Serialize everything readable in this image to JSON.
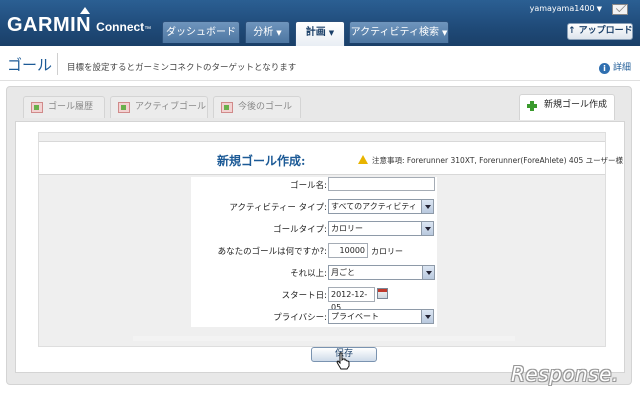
{
  "app": {
    "logo_main": "GARMIN",
    "logo_sub": "Connect",
    "logo_tm": "™",
    "user": "yamayama1400",
    "upload_label": "↑ アップロード"
  },
  "nav": {
    "tabs": [
      {
        "label": "ダッシュボード",
        "active": false,
        "has_menu": false
      },
      {
        "label": "分析",
        "active": false,
        "has_menu": true
      },
      {
        "label": "計画",
        "active": true,
        "has_menu": true
      },
      {
        "label": "アクティビティ検索",
        "active": false,
        "has_menu": true
      }
    ]
  },
  "page": {
    "title": "ゴール",
    "description": "目標を設定するとガーミンコネクトのターゲットとなります",
    "help_label": "詳細"
  },
  "subtabs": [
    {
      "label": "ゴール履歴",
      "icon": "goal-history-icon",
      "active": false
    },
    {
      "label": "アクティブゴール",
      "icon": "active-goal-icon",
      "active": false
    },
    {
      "label": "今後のゴール",
      "icon": "future-goal-icon",
      "active": false
    },
    {
      "label": "新規ゴール作成",
      "icon": "plus-icon",
      "active": true
    }
  ],
  "form": {
    "title": "新規ゴール作成:",
    "warning": "注意事項: Forerunner 310XT, Forerunner(ForeAhlete) 405 ユーザー様",
    "fields": {
      "goal_name": {
        "label": "ゴール名:",
        "value": ""
      },
      "activity_type": {
        "label": "アクティビティー タイプ:",
        "value": "すべてのアクティビティ"
      },
      "goal_type": {
        "label": "ゴールタイプ:",
        "value": "カロリー"
      },
      "goal_amount": {
        "label": "あなたのゴールは何ですか?:",
        "value": "10000",
        "unit": "カロリー"
      },
      "period": {
        "label": "それ以上:",
        "value": "月ごと"
      },
      "start_date": {
        "label": "スタート日:",
        "value": "2012-12-05"
      },
      "privacy": {
        "label": "プライバシー:",
        "value": "プライベート"
      }
    },
    "save_label": "保存"
  },
  "watermark": "Response."
}
